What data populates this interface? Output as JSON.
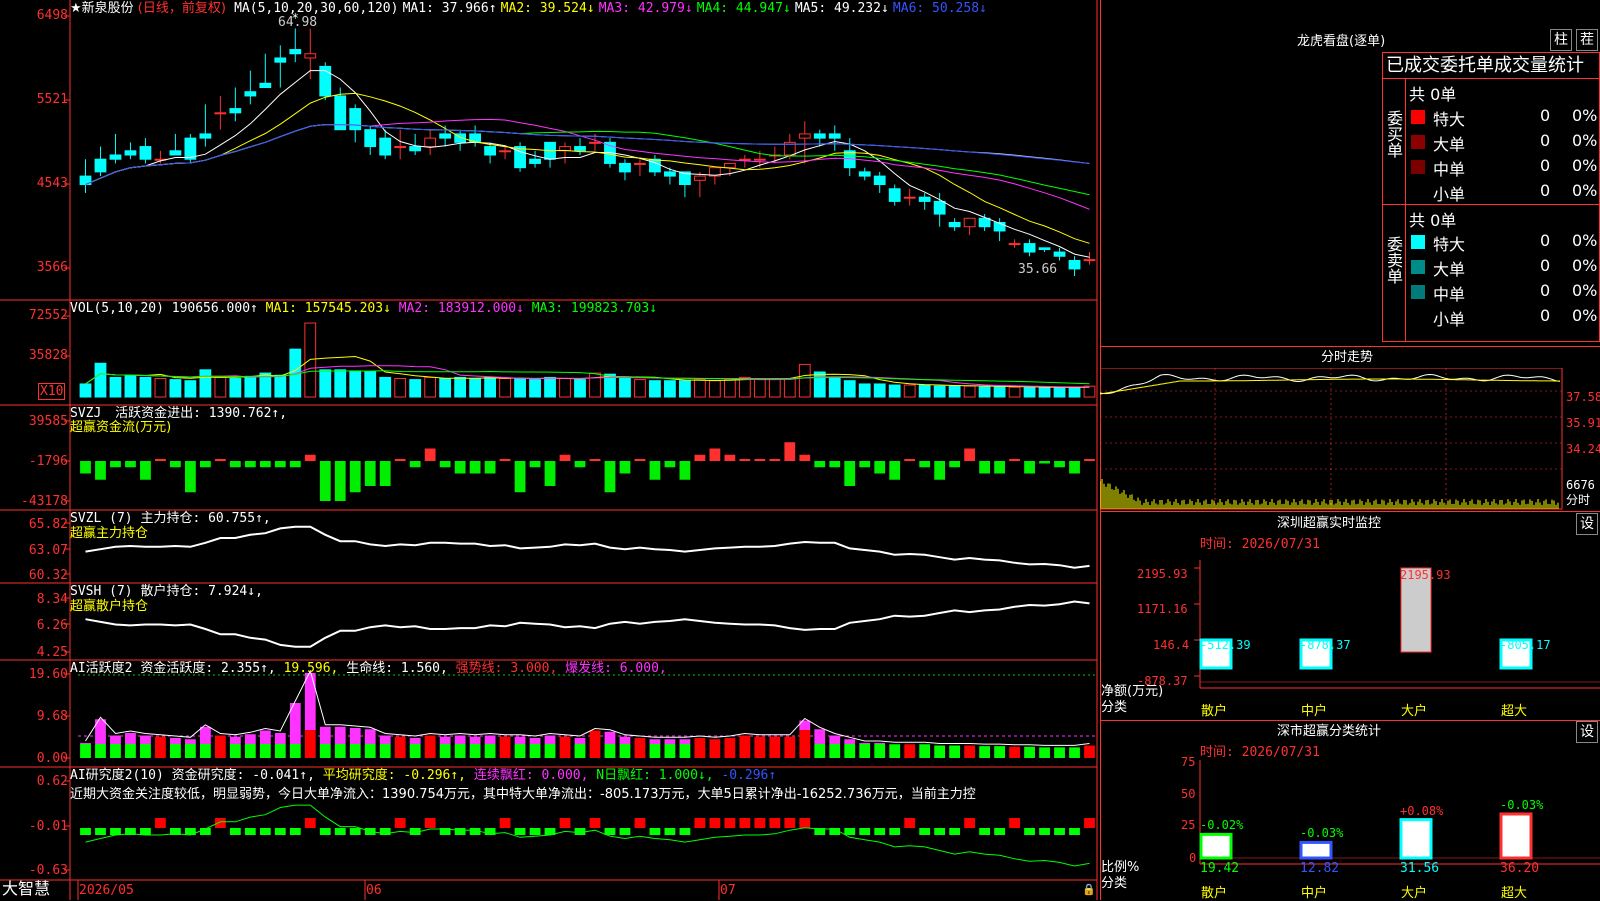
{
  "stock": {
    "name": "★新泉股份",
    "mode": "(日线，前复权)",
    "ma_label": "MA(5,10,20,30,60,120)",
    "ma1": "MA1: 37.966↑",
    "ma2": "MA2: 39.524↓",
    "ma3": "MA3: 42.979↓",
    "ma4": "MA4: 44.947↓",
    "ma5": "MA5: 49.232↓",
    "ma6": "MA6: 50.258↓",
    "high_mark": "64.98",
    "low_mark": "35.66"
  },
  "price_axis": [
    "6498",
    "5521",
    "4543",
    "3566"
  ],
  "vol": {
    "label": "VOL(5,10,20)",
    "value": "190656.000↑",
    "ma1": "MA1: 157545.203↓",
    "ma2": "MA2: 183912.000↓",
    "ma3": "MA3: 199823.703↓",
    "axis": [
      "72552",
      "35828"
    ],
    "unit": "X10"
  },
  "svzj": {
    "label": "SVZJ",
    "value": "活跃资金进出: 1390.762↑,",
    "title": "超赢资金流(万元)",
    "axis": [
      "39585",
      "-1796",
      "-43178"
    ]
  },
  "svzl": {
    "label": "SVZL (7)",
    "value": "主力持仓: 60.755↑,",
    "title": "超赢主力持仓",
    "axis": [
      "65.82",
      "63.07",
      "60.32"
    ]
  },
  "svsh": {
    "label": "SVSH (7)",
    "value": "散户持仓: 7.924↓,",
    "title": "超赢散户持仓",
    "axis": [
      "8.34",
      "6.26",
      "4.25"
    ]
  },
  "ai2": {
    "label": "AI活跃度2",
    "value": "资金活跃度: 2.355↑,",
    "v2": "19.596,",
    "v3": "生命线: 1.560,",
    "v4": "强势线: 3.000,",
    "v5": "爆发线: 6.000,",
    "axis": [
      "19.60",
      "9.68",
      "0.00"
    ]
  },
  "ai_research": {
    "label": "AI研究度2(10)",
    "value": "资金研究度: -0.041↑,",
    "v2": "平均研究度: -0.296↑,",
    "v3": "连续飘红: 0.000,",
    "v4": "N日飘红: 1.000↓,",
    "v5": "-0.296↑",
    "comment": "近期大资金关注度较低，明显弱势，今日大单净流入：1390.754万元，其中特大单净流出：-805.173万元，大单5日累计净出-16252.736万元，当前主力控",
    "axis": [
      "0.62",
      "-0.01",
      "-0.63"
    ]
  },
  "date_axis": {
    "logo": "大智慧",
    "labels": [
      "2026/05",
      "06",
      "07"
    ]
  },
  "dragon_tiger": {
    "title": "龙虎看盘(逐单)",
    "btn_bar": "柱",
    "btn_pie": "茬",
    "subtitle": "已成交委托单成交量统计",
    "buy_label": "委买单",
    "sell_label": "委卖单",
    "buy_total": "共 0单",
    "sell_total": "共 0单",
    "buy_rows": [
      {
        "name": "特大",
        "count": "0",
        "pct": "0%",
        "color": "#ff0000"
      },
      {
        "name": "大单",
        "count": "0",
        "pct": "0%",
        "color": "#8b0000"
      },
      {
        "name": "中单",
        "count": "0",
        "pct": "0%",
        "color": "#7a0000"
      },
      {
        "name": "小单",
        "count": "0",
        "pct": "0%",
        "color": "#000000"
      }
    ],
    "sell_rows": [
      {
        "name": "特大",
        "count": "0",
        "pct": "0%",
        "color": "#00ffff"
      },
      {
        "name": "大单",
        "count": "0",
        "pct": "0%",
        "color": "#008b8b"
      },
      {
        "name": "中单",
        "count": "0",
        "pct": "0%",
        "color": "#007a7a"
      },
      {
        "name": "小单",
        "count": "0",
        "pct": "0%",
        "color": "#000000"
      }
    ]
  },
  "intraday": {
    "title": "分时走势",
    "axis": [
      "37.58",
      "35.91",
      "34.24",
      "6676"
    ],
    "vol_label": "分时"
  },
  "sz_monitor": {
    "title": "深圳超赢实时监控",
    "btn": "设",
    "time": "时间: 2026/07/31",
    "axis": [
      "2195.93",
      "1171.16",
      "146.4",
      "-878.37"
    ],
    "ylabel": "净额(万元)",
    "xlabel": "分类",
    "categories": [
      "散户",
      "中户",
      "大户",
      "超大"
    ],
    "values_text": [
      "-512.39",
      "-878.37",
      "2195.93",
      "-805.17"
    ]
  },
  "sz_stats": {
    "title": "深市超赢分类统计",
    "btn": "设",
    "time": "时间: 2026/07/31",
    "axis": [
      "75",
      "50",
      "25",
      "0"
    ],
    "ylabel": "比例%",
    "xlabel": "分类",
    "categories": [
      "散户",
      "中户",
      "大户",
      "超大"
    ],
    "change_text": [
      "-0.02%",
      "-0.03%",
      "+0.08%",
      "-0.03%"
    ],
    "values_text": [
      "19.42",
      "12.82",
      "31.56",
      "36.20"
    ]
  },
  "chart_data": [
    {
      "type": "candlestick",
      "name": "price",
      "ylim": [
        3400,
        6600
      ],
      "ohlc": [
        [
          4750,
          4950,
          4650,
          4550
        ],
        [
          4950,
          5100,
          4800,
          4750
        ],
        [
          5000,
          5250,
          4950,
          4900
        ],
        [
          5050,
          5150,
          5000,
          4950
        ],
        [
          5100,
          5200,
          4950,
          4900
        ],
        [
          4950,
          5050,
          4950,
          4900
        ],
        [
          5050,
          5250,
          5000,
          5000
        ],
        [
          5200,
          5250,
          4950,
          4900
        ],
        [
          5250,
          5600,
          5200,
          5100
        ],
        [
          5500,
          5700,
          5500,
          5300
        ],
        [
          5550,
          5800,
          5500,
          5400
        ],
        [
          5750,
          6000,
          5700,
          5600
        ],
        [
          5850,
          6200,
          5800,
          5800
        ],
        [
          6150,
          6300,
          6100,
          5800
        ],
        [
          6250,
          6500,
          6200,
          6100
        ],
        [
          6150,
          6498,
          6200,
          5900
        ],
        [
          6050,
          6100,
          5700,
          5650
        ],
        [
          5700,
          5800,
          5300,
          5300
        ],
        [
          5550,
          5600,
          5300,
          5150
        ],
        [
          5300,
          5350,
          5100,
          5000
        ],
        [
          5200,
          5300,
          5000,
          4950
        ],
        [
          5100,
          5300,
          5100,
          4950
        ],
        [
          5100,
          5250,
          5050,
          5000
        ],
        [
          5100,
          5300,
          5200,
          5000
        ],
        [
          5250,
          5350,
          5200,
          5100
        ],
        [
          5250,
          5300,
          5150,
          5050
        ],
        [
          5250,
          5350,
          5150,
          5100
        ],
        [
          5100,
          5150,
          5000,
          4900
        ],
        [
          5050,
          5100,
          5050,
          4950
        ],
        [
          5100,
          5150,
          4850,
          4800
        ],
        [
          4950,
          5050,
          4900,
          4850
        ],
        [
          5150,
          5150,
          4950,
          4850
        ],
        [
          5050,
          5150,
          5100,
          4900
        ],
        [
          5100,
          5200,
          5050,
          5000
        ],
        [
          5150,
          5250,
          5150,
          5050
        ],
        [
          5150,
          5200,
          4900,
          4850
        ],
        [
          4900,
          4950,
          4800,
          4700
        ],
        [
          4900,
          4950,
          4900,
          4750
        ],
        [
          4950,
          5000,
          4800,
          4750
        ],
        [
          4800,
          4850,
          4750,
          4650
        ],
        [
          4800,
          4800,
          4650,
          4500
        ],
        [
          4700,
          4800,
          4750,
          4500
        ],
        [
          4750,
          4850,
          4850,
          4650
        ],
        [
          4850,
          4900,
          4900,
          4750
        ],
        [
          4950,
          5000,
          4950,
          4850
        ],
        [
          4950,
          5050,
          4950,
          4850
        ],
        [
          5000,
          5100,
          5000,
          4900
        ],
        [
          5000,
          5250,
          5150,
          4950
        ],
        [
          5200,
          5400,
          5250,
          4900
        ],
        [
          5250,
          5300,
          5200,
          5100
        ],
        [
          5250,
          5350,
          5200,
          5050
        ],
        [
          5050,
          5200,
          4850,
          4750
        ],
        [
          4800,
          4850,
          4750,
          4700
        ],
        [
          4750,
          4800,
          4650,
          4550
        ],
        [
          4600,
          4650,
          4450,
          4400
        ],
        [
          4500,
          4600,
          4500,
          4400
        ],
        [
          4500,
          4550,
          4450,
          4350
        ],
        [
          4450,
          4550,
          4300,
          4150
        ],
        [
          4200,
          4250,
          4150,
          4100
        ],
        [
          4150,
          4250,
          4250,
          4050
        ],
        [
          4250,
          4300,
          4150,
          4100
        ],
        [
          4200,
          4250,
          4100,
          3980
        ],
        [
          3950,
          4000,
          3950,
          3900
        ],
        [
          3950,
          4000,
          3850,
          3800
        ],
        [
          3900,
          3900,
          3880,
          3850
        ],
        [
          3850,
          3900,
          3800,
          3750
        ],
        [
          3750,
          3800,
          3650,
          3566
        ],
        [
          3750,
          3850,
          3760,
          3700
        ]
      ]
    },
    {
      "type": "bar",
      "name": "volume",
      "ylim": [
        0,
        80000
      ],
      "values": [
        12000,
        31000,
        18000,
        20000,
        18000,
        17000,
        16000,
        15000,
        25000,
        18000,
        17000,
        19000,
        22000,
        20000,
        44000,
        68000,
        25000,
        25000,
        24000,
        23000,
        18000,
        17000,
        16000,
        18000,
        17000,
        18000,
        17000,
        18000,
        17000,
        17000,
        16000,
        18000,
        17000,
        16000,
        22000,
        21000,
        17000,
        16000,
        15000,
        15000,
        15000,
        16000,
        15000,
        16000,
        18000,
        17000,
        17000,
        17000,
        30000,
        23000,
        18000,
        15000,
        12000,
        12000,
        11000,
        11000,
        11000,
        10000,
        10000,
        10000,
        9500,
        9500,
        9000,
        9000,
        8500,
        8500,
        8500,
        10000
      ]
    }
  ]
}
